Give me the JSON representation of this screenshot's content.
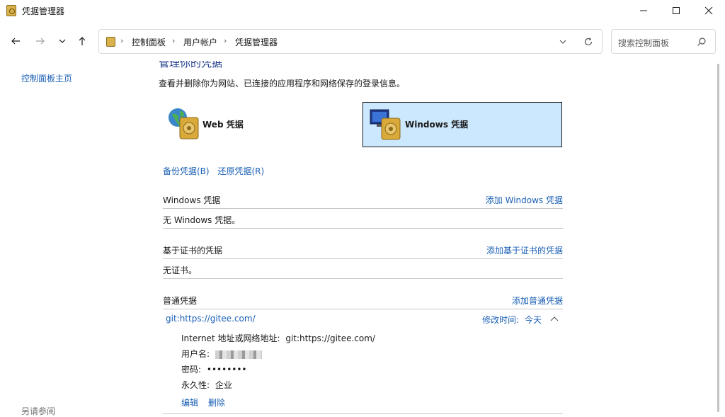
{
  "window": {
    "title": "凭据管理器"
  },
  "address": {
    "crumbs": [
      "控制面板",
      "用户帐户",
      "凭据管理器"
    ]
  },
  "search": {
    "placeholder": "搜索控制面板"
  },
  "sidebar": {
    "home": "控制面板主页",
    "see_also": "另请参阅"
  },
  "main": {
    "heading": "管理你的凭据",
    "subtitle": "查看并删除你为网站、已连接的应用程序和网络保存的登录信息。",
    "tiles": {
      "web": "Web 凭据",
      "windows": "Windows 凭据",
      "selected": "windows"
    },
    "links": {
      "backup": "备份凭据(B)",
      "restore": "还原凭据(R)"
    },
    "sections": {
      "windows": {
        "title": "Windows 凭据",
        "add": "添加 Windows 凭据",
        "empty": "无 Windows 凭据。"
      },
      "cert": {
        "title": "基于证书的凭据",
        "add": "添加基于证书的凭据",
        "empty": "无证书。"
      },
      "generic": {
        "title": "普通凭据",
        "add": "添加普通凭据",
        "item": {
          "name": "git:https://gitee.com/",
          "modified_label": "修改时间:",
          "modified_value": "今天",
          "address_label": "Internet 地址或网络地址:",
          "address_value": "git:https://gitee.com/",
          "username_label": "用户名:",
          "password_label": "密码:",
          "password_value": "••••••••",
          "persistence_label": "永久性:",
          "persistence_value": "企业",
          "edit": "编辑",
          "remove": "删除"
        }
      }
    }
  },
  "colors": {
    "link": "#1a5fb4",
    "selected_tile": "#cce8ff",
    "heading": "#1e3a8a"
  }
}
